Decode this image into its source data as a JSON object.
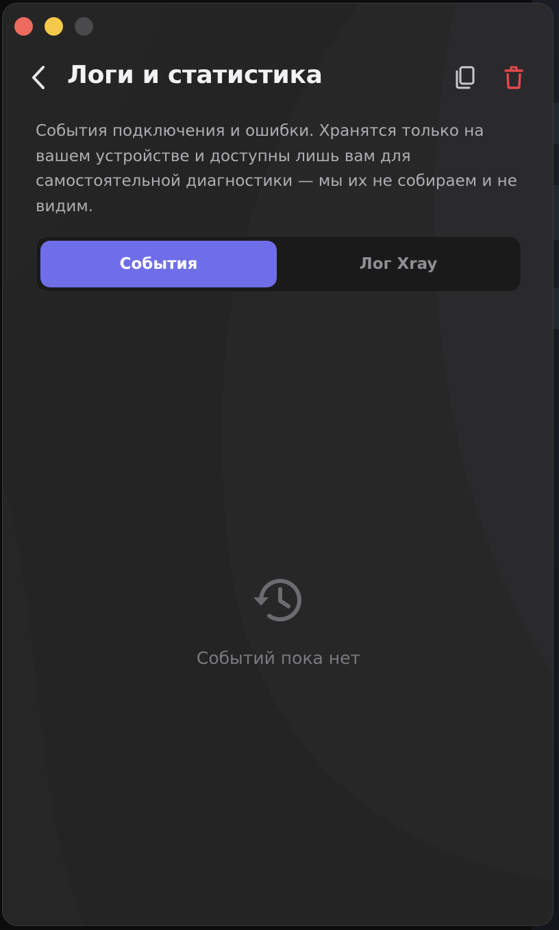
{
  "window": {
    "controls": [
      "close",
      "minimize",
      "maximize"
    ]
  },
  "header": {
    "title": "Логи и статистика",
    "back_icon": "chevron-left-icon",
    "copy_icon": "copy-icon",
    "delete_icon": "trash-icon"
  },
  "description": "События подключения и ошибки. Хранятся только на вашем устройстве и доступны лишь вам для самостоятельной диагностики — мы их не собираем и не видим.",
  "tabs": [
    {
      "label": "События",
      "active": true
    },
    {
      "label": "Лог Xray",
      "active": false
    }
  ],
  "empty_state": {
    "icon": "history-icon",
    "text": "Событий пока нет"
  },
  "colors": {
    "accent": "#6f6ee8",
    "danger": "#e5484d",
    "background": "#242425",
    "title": "#f2f2f4",
    "muted": "#7b7b80"
  }
}
